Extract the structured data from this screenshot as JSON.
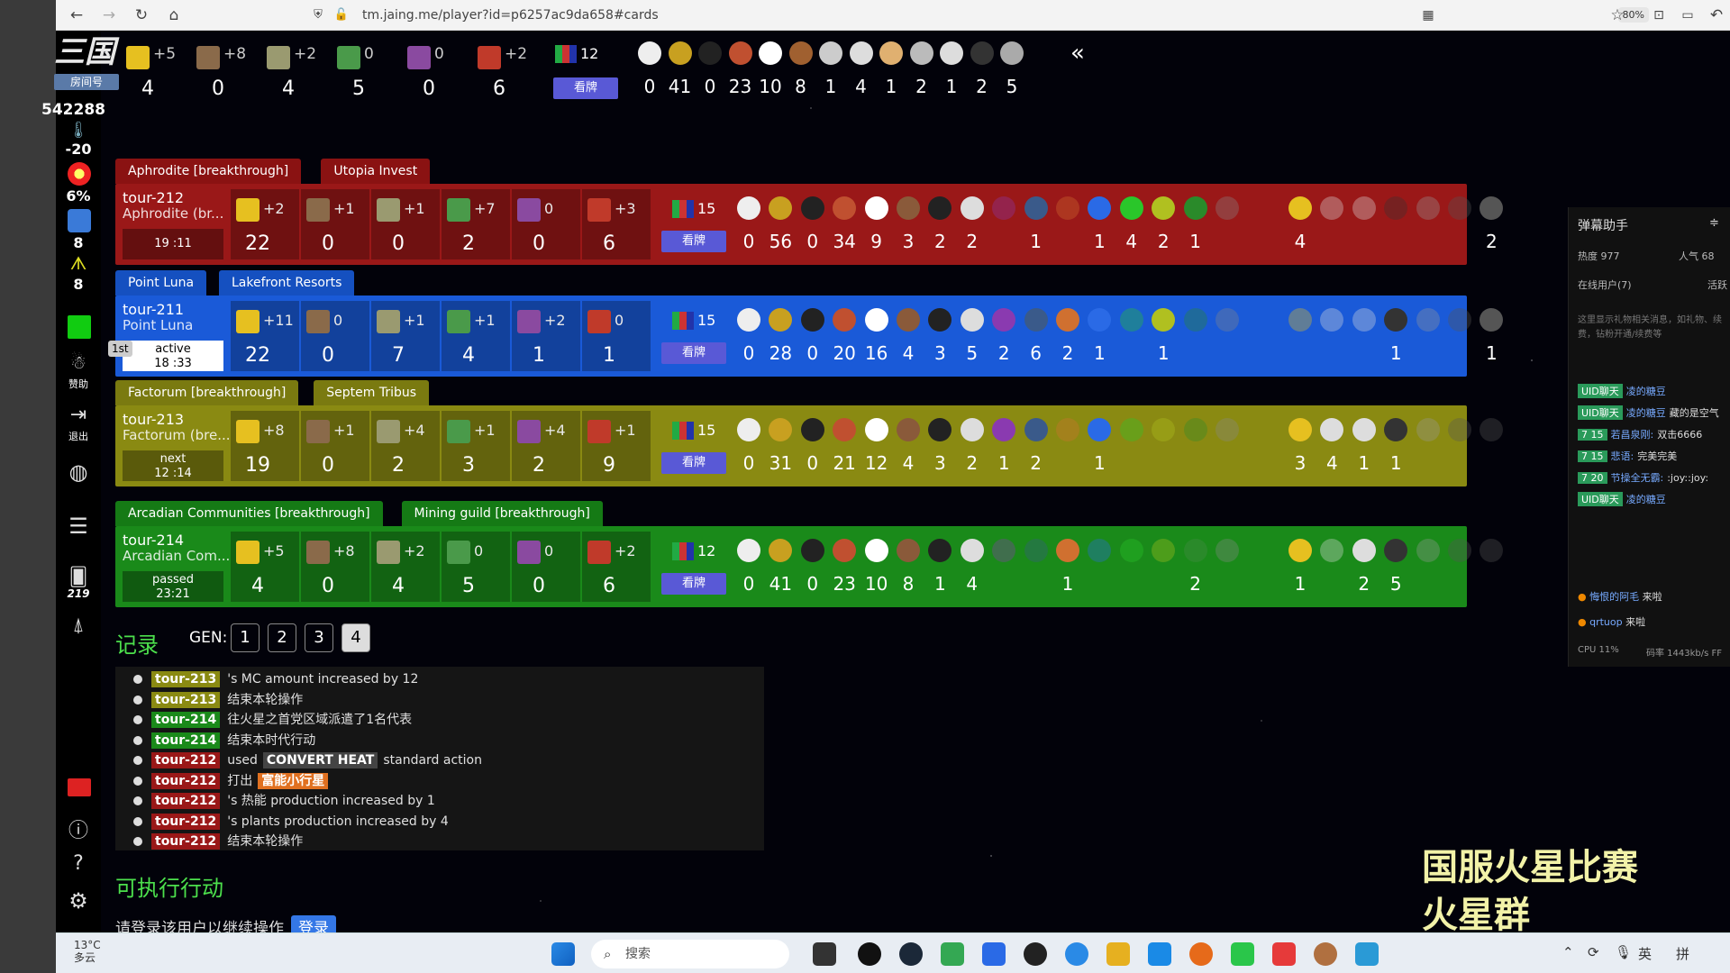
{
  "browser": {
    "url": "tm.jaing.me/player?id=p6257ac9da658#cards",
    "zoom": "80%"
  },
  "sidebar": {
    "logo_text": "三国",
    "badge": "房间号",
    "viewers": "542288",
    "temperature": "-20",
    "oxygen": "6%",
    "oceans": "8",
    "venus": "8",
    "sponsor_label": "赞助",
    "quit_label": "退出",
    "cards_count": "219"
  },
  "top_stats": {
    "resources": [
      {
        "icon": "megacredit-icon",
        "color": "#e6c020",
        "prod": "+5",
        "value": "4"
      },
      {
        "icon": "steel-icon",
        "color": "#8a6a4a",
        "prod": "+8",
        "value": "0",
        "level": "2"
      },
      {
        "icon": "titanium-icon",
        "color": "#9a9a70",
        "prod": "+2",
        "value": "4",
        "level": "4"
      },
      {
        "icon": "plant-icon",
        "color": "#4a9a4a",
        "prod": "0",
        "value": "5"
      },
      {
        "icon": "energy-icon",
        "color": "#8a4aa0",
        "prod": "0",
        "value": "0"
      },
      {
        "icon": "heat-icon",
        "color": "#c03a2a",
        "prod": "+2",
        "value": "6"
      }
    ],
    "tags_total": "12",
    "view_label": "看牌",
    "counts": [
      "0",
      "41",
      "0",
      "23",
      "10",
      "8",
      "1",
      "4",
      "1",
      "2",
      "1",
      "2",
      "5"
    ]
  },
  "players": [
    {
      "tab1": "Aphrodite [breakthrough]",
      "tab2": "Utopia Invest",
      "name": "tour-212",
      "corp": "Aphrodite (br...",
      "status": "19 :11",
      "color": "#9a1818",
      "tabcolor": "#8a1212",
      "resources": [
        [
          "+2",
          "22"
        ],
        [
          "+1",
          "0"
        ],
        [
          "+1",
          "0"
        ],
        [
          "+7",
          "2"
        ],
        [
          "0",
          "0"
        ],
        [
          "+3",
          "6"
        ]
      ],
      "steel_level": "2",
      "ti_level": "4",
      "tags_total": "15",
      "view_label": "看牌",
      "counts": [
        "0",
        "56",
        "0",
        "34",
        "9",
        "3",
        "2",
        "2",
        "",
        "1",
        "",
        "1",
        "4",
        "2",
        "1",
        "",
        "4",
        "",
        "",
        "",
        "",
        "",
        "2"
      ]
    },
    {
      "tab1": "Point Luna",
      "tab2": "Lakefront Resorts",
      "name": "tour-211",
      "corp": "Point Luna",
      "status": "active",
      "time": "18 :33",
      "rank": "1st",
      "color": "#1a5ad8",
      "tabcolor": "#1550c0",
      "resources": [
        [
          "+11",
          "22"
        ],
        [
          "0",
          "0"
        ],
        [
          "+1",
          "7"
        ],
        [
          "+1",
          "4"
        ],
        [
          "+2",
          "1"
        ],
        [
          "0",
          "1"
        ]
      ],
      "steel_level": "2",
      "ti_level": "4",
      "tags_total": "15",
      "view_label": "看牌",
      "counts": [
        "0",
        "28",
        "0",
        "20",
        "16",
        "4",
        "3",
        "5",
        "2",
        "6",
        "2",
        "1",
        "",
        "1",
        "",
        "",
        "",
        "",
        "",
        "1",
        "",
        "",
        "1"
      ]
    },
    {
      "tab1": "Factorum [breakthrough]",
      "tab2": "Septem Tribus",
      "name": "tour-213",
      "corp": "Factorum (bre...",
      "status": "next",
      "time": "12 :14",
      "color": "#8a8a12",
      "tabcolor": "#7a7a10",
      "resources": [
        [
          "+8",
          "19"
        ],
        [
          "+1",
          "0"
        ],
        [
          "+4",
          "2"
        ],
        [
          "+1",
          "3"
        ],
        [
          "+4",
          "2"
        ],
        [
          "+1",
          "9"
        ]
      ],
      "steel_level": "2",
      "ti_level": "5",
      "tags_total": "15",
      "view_label": "看牌",
      "counts": [
        "0",
        "31",
        "0",
        "21",
        "12",
        "4",
        "3",
        "2",
        "1",
        "2",
        "",
        "1",
        "",
        "",
        "",
        "",
        "3",
        "4",
        "1",
        "1",
        "",
        "",
        ""
      ]
    },
    {
      "tab1": "Arcadian Communities [breakthrough]",
      "tab2": "Mining guild [breakthrough]",
      "name": "tour-214",
      "corp": "Arcadian Com...",
      "status": "passed",
      "time": "23:21",
      "color": "#1a8a1a",
      "tabcolor": "#157a15",
      "resources": [
        [
          "+5",
          "4"
        ],
        [
          "+8",
          "0"
        ],
        [
          "+2",
          "4"
        ],
        [
          "0",
          "5"
        ],
        [
          "0",
          "0"
        ],
        [
          "+2",
          "6"
        ]
      ],
      "steel_level": "2",
      "ti_level": "4",
      "tags_total": "12",
      "view_label": "看牌",
      "counts": [
        "0",
        "41",
        "0",
        "23",
        "10",
        "8",
        "1",
        "4",
        "",
        "",
        "1",
        "",
        "",
        "",
        "2",
        "",
        "1",
        "",
        "2",
        "5",
        "",
        "",
        ""
      ]
    }
  ],
  "log": {
    "title": "记录",
    "gen_label": "GEN:",
    "gens": [
      "1",
      "2",
      "3",
      "4"
    ],
    "lines": [
      {
        "tag": "tour-213",
        "tagcolor": "#8a8a12",
        "text": "'s MC amount increased by 12"
      },
      {
        "tag": "tour-213",
        "tagcolor": "#8a8a12",
        "text": "结束本轮操作"
      },
      {
        "tag": "tour-214",
        "tagcolor": "#1a8a1a",
        "text": "往火星之首党区域派遣了1名代表"
      },
      {
        "tag": "tour-214",
        "tagcolor": "#1a8a1a",
        "text": "结束本时代行动"
      },
      {
        "tag": "tour-212",
        "tagcolor": "#9a1818",
        "text_before": "used",
        "badge": "CONVERT HEAT",
        "badgecolor": "#444",
        "text": "standard action"
      },
      {
        "tag": "tour-212",
        "tagcolor": "#9a1818",
        "text_before": "打出",
        "badge": "富能小行星",
        "badgecolor": "#e07020",
        "text": ""
      },
      {
        "tag": "tour-212",
        "tagcolor": "#9a1818",
        "text": "'s 热能 production increased by 1"
      },
      {
        "tag": "tour-212",
        "tagcolor": "#9a1818",
        "text": "'s plants production increased by 4"
      },
      {
        "tag": "tour-212",
        "tagcolor": "#9a1818",
        "text": "结束本轮操作"
      }
    ]
  },
  "actions": {
    "title": "可执行行动",
    "login_text": "请登录该用户以继续操作",
    "login_button": "登录"
  },
  "danmu": {
    "title": "弹幕助手",
    "heat": "热度 977",
    "popularity": "人气 68",
    "online": "在线用户(7)",
    "active": "活跃",
    "hint": "这里显示礼物相关消息，如礼物、续费，钻粉开通/续费等",
    "messages": [
      {
        "badge": "UID聊天",
        "name": "凌的糖豆",
        "text": ""
      },
      {
        "badge": "UID聊天",
        "name": "凌的糖豆",
        "text": "藏的是空气"
      },
      {
        "badge": "7 15",
        "name": "若昌泉刚:",
        "text": "双击6666"
      },
      {
        "badge": "7 15",
        "name": "悲语:",
        "text": "完美完美"
      },
      {
        "badge": "7 20",
        "name": "节操全无霸:",
        "text": ":joy::joy:"
      },
      {
        "badge": "UID聊天",
        "name": "凌的糖豆",
        "text": ""
      }
    ],
    "join1_name": "悔恨的阿毛",
    "join1_text": "来啦",
    "join2_name": "qrtuop",
    "join2_text": "来啦",
    "cpu": "CPU 11%",
    "bitrate": "码率 1443kb/s FF"
  },
  "overlay": {
    "line1": "国服火星比赛",
    "line2": "火星群 859050306"
  },
  "taskbar": {
    "temp": "13°C",
    "weather": "多云",
    "search": "搜索",
    "lang1": "英",
    "lang2": "拼"
  }
}
